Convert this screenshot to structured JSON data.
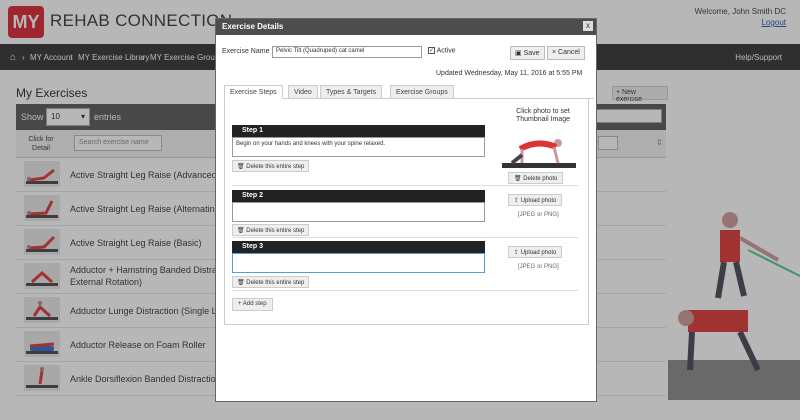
{
  "app": {
    "logo_mark": "MY",
    "logo_text": "REHAB CONNECTION",
    "welcome": "Welcome, John Smith DC",
    "logout": "Logout"
  },
  "nav": {
    "items": [
      "MY Account",
      "MY Exercise Library",
      "MY Exercise Groups"
    ],
    "separator": "›",
    "help": "Help/Support"
  },
  "list": {
    "heading": "My Exercises",
    "new_exercise": "+ New exercise",
    "show_label": "Show",
    "show_value": "10",
    "entries_label": "entries",
    "col_click": "Click for Detail",
    "search_placeholder": "Search exercise name",
    "rows": [
      "Active Straight Leg Raise (Advanced",
      "Active Straight Leg Raise (Alternatin",
      "Active Straight Leg Raise (Basic)",
      "Adductor + Hamstring Banded Distra External Rotation)",
      "Adductor Lunge Distraction (Single L",
      "Adductor Release on Foam Roller",
      "Ankle Dorsiflexion Banded Distractio"
    ]
  },
  "modal": {
    "title": "Exercise Details",
    "close": "x",
    "name_label": "Exercise Name",
    "name_value": "Pelvic Tilt (Quadruped) cat camel",
    "active_label": "Active",
    "save": "Save",
    "cancel": "Cancel",
    "updated": "Updated Wednesday, May 11, 2016 at 5:55 PM",
    "tabs": [
      "Exercise Steps",
      "Video",
      "Types & Targets",
      "Exercise Groups"
    ],
    "thumb_hint": "Click photo to set Thumbnail Image",
    "steps": [
      {
        "label": "Step 1",
        "text": "Begin on your hands and knees with your spine relaxed.",
        "photo_button": "Delete photo",
        "hint": ""
      },
      {
        "label": "Step 2",
        "text": "",
        "photo_button": "Upload photo",
        "hint": "[JPEG or PNG]"
      },
      {
        "label": "Step 3",
        "text": "",
        "photo_button": "Upload photo",
        "hint": "[JPEG or PNG]"
      }
    ],
    "delete_step": "Delete this entire step",
    "add_step": "Add step"
  }
}
